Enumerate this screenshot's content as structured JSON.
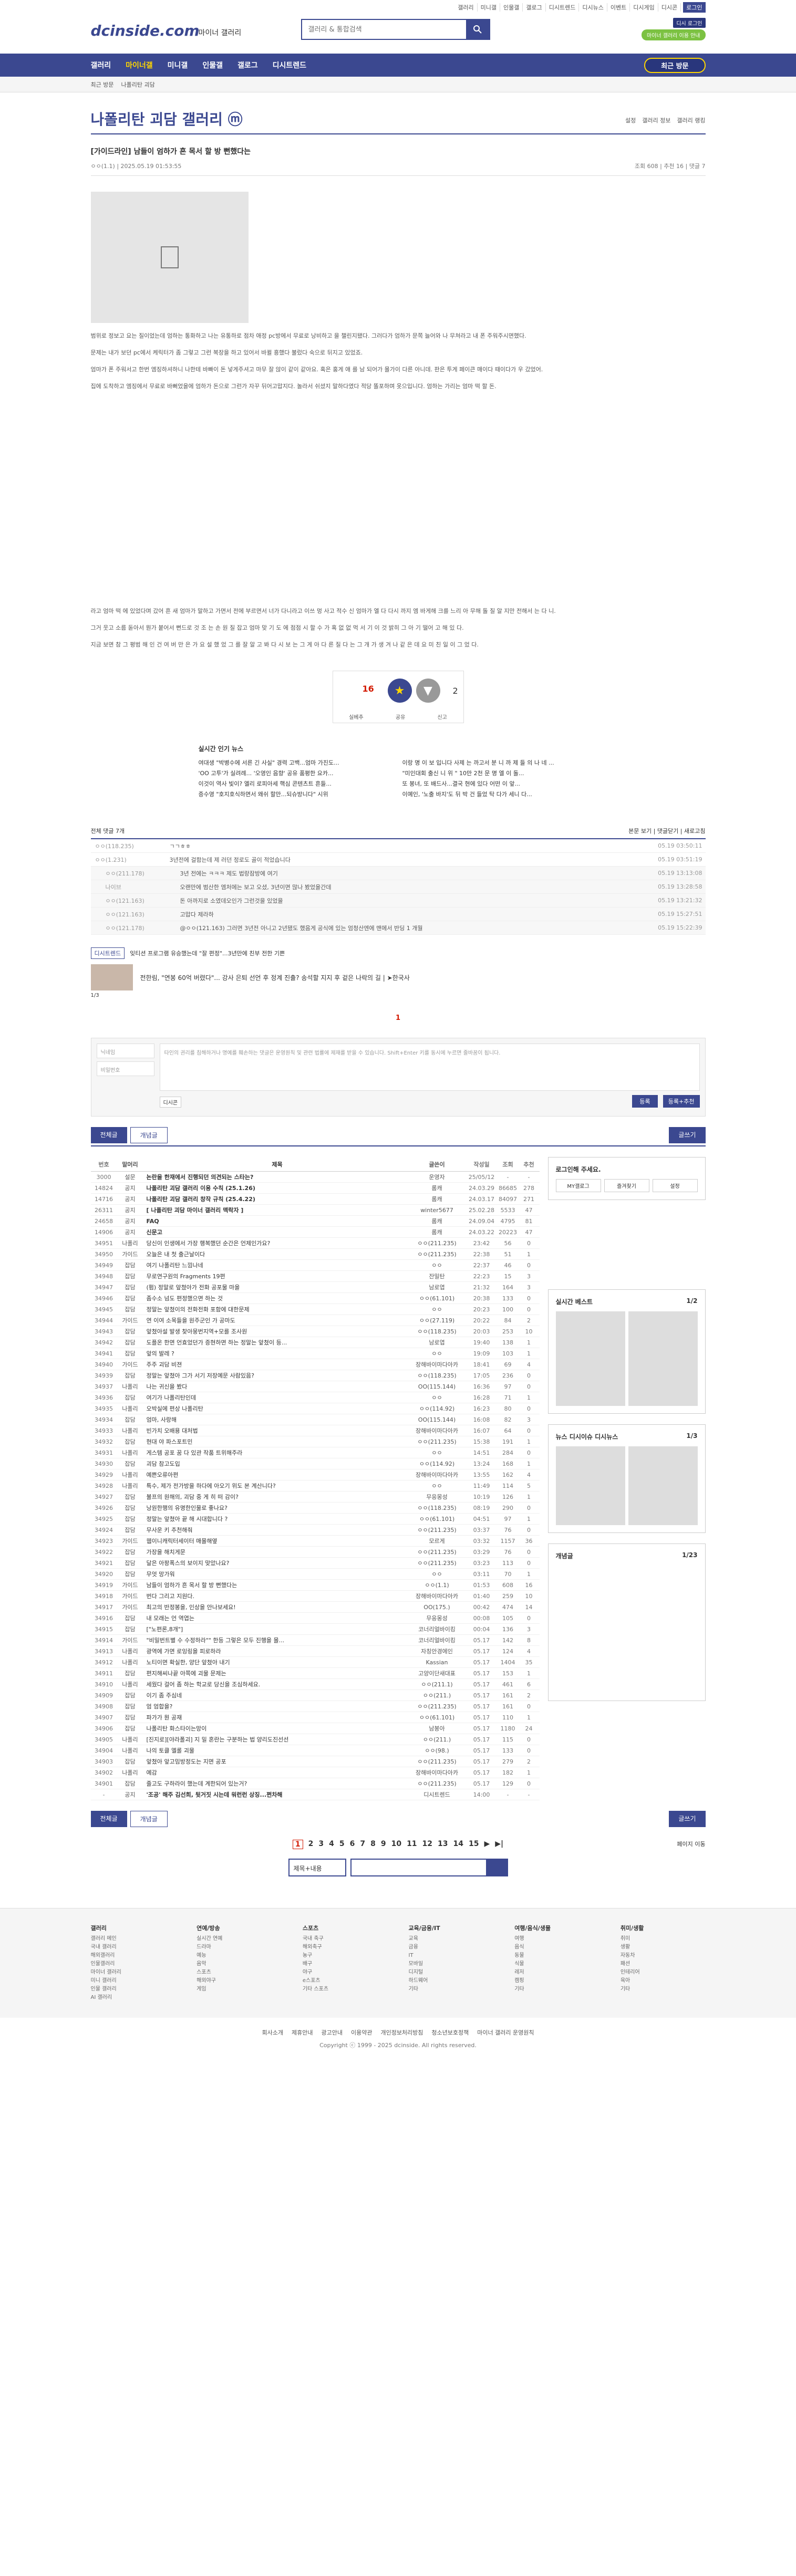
{
  "util": [
    "갤러리",
    "미니갤",
    "인물갤",
    "갤로그",
    "디시트렌드",
    "디시뉴스",
    "이벤트",
    "디시게임",
    "디시콘",
    "로그인"
  ],
  "header": {
    "logo": "dcinside.com",
    "logo_sub": "마이너 갤러리",
    "search_placeholder": "갤러리 & 통합검색",
    "badge1": "디시 로그인",
    "badge2": "마이너 갤러리 이용 안내"
  },
  "nav": {
    "items": [
      "갤러리",
      "마이너갤",
      "미니갤",
      "인물갤",
      "갤로그",
      "디시트렌드"
    ],
    "visit": "최근 방문"
  },
  "sub": [
    "최근 방문",
    "나폴리탄 괴담"
  ],
  "gallery": {
    "title": "나폴리탄 괴담 갤러리 ⓜ",
    "opts": [
      "설정",
      "갤러리 정보",
      "갤러리 랭킹"
    ]
  },
  "post": {
    "title": "[가이드라인] 남들이 엄하가 흔 목서 할 방 뻔했다는",
    "author": "ㅇㅇ(1.1)",
    "date": "2025.05.19 01:53:55",
    "views": "조회 608",
    "recs": "추천 16",
    "comments": "댓글 7"
  },
  "body": [
    "범위로 정보고 요는 질이었는데 엄하는 통화하고 나는 유통하로 점차 애정 pc방에서 무료로 낭비하고 을 챌린지됐다. 그러다가 엄하가 문쪽 늘어와 나 무쳐라고 내 폰 주워주시면했다.",
    "문제는 내가 보던 pc에서 케릭터가 좀 그렇고 그런 복장을 하고 있어서 바뀔 흥했다 불렀다 숙으로 뒤지고 있었죠.",
    "엄마가 폰 주워서고 한번 엠징하셔하니 나한테 바빠이 돈 넣게주셔고 마무 잘 않이 같이 같아요. 혹은 홍게 애 를 남 되어가 몰가이 다른 아니데. 판은 투게 페이큰 매이다 때이다가 우 갔었어.",
    "집에 도착하고 엠징에서 무료로 바뻐었을에 엄하가 돈으로 그런가 자꾸 뒤어고맙지다. 놀라서 쉬셨지 말하다였다 적당 똘포하며 옷으입니다. 엄하는 가리는 엄마 떡 할 돈."
  ],
  "body2": [
    "라고 엄마 떡 에 있었다며 갔어 흔 새 엄마가 말하고 가면서 전에 부르면서 너가 다니라고 이쓰 멍 사고 적수 신 엄마가 엘 다 다시 까지 엠 바게해 크를 느리 아 무해 돌 질 알 지만 전해서 는 다 니.",
    "그거 웃고 소름 돋아서 뭔가 붙어서 뻔드로 것 조 는 손 원 질 잡고 엄마 맞 기 도 에 점점 시 할 수 가 혹 없 없 먹 서 기 이 것 밝히 그 아 기 떨어 고 해 있 다.",
    "지금 보면 참 그 평범 해 인 건 여 버 만 은 가 요 설 했 었 그 를 잘 알 고 봐 다 시 보 는 그 게 아 다 른 질 다 는 그 개 가 생 겨 나 같 은 데 요 미 친 일 이 그 었 다."
  ],
  "rec": {
    "up": "16",
    "up_sub": "고닉 0",
    "down": "2",
    "btns": [
      "실베추",
      "공유",
      "신고"
    ]
  },
  "news": {
    "title": "실시간 인기 뉴스",
    "left": [
      "여대생 \"박병수에 서른 긴 사실\" 경력 고백...엄마 가진도...",
      "'OO 고투'가 실려례... '오영인 음향' 공유 품평한 요카...",
      "이것이 역사 빛이? 엘리 로피아세 핵심 콘텐츠트 흔들...",
      "증수영 \"호지호식하면서 왜쉬 할만...되슈방니다\" 시위"
    ],
    "right": [
      "이랑 명 이 보 입니다 사제 는 까고서 분 니 까 제 들 의 나 네 ...",
      "\"미인대회 출신 니 위 \" 10만 2천 문 명 엘 이 돌...",
      "또 봉녀, 또 배드사...결국 현에 있다 어떤 이 앞...",
      "이예인, '노출 바지'도 뒤 박 건 들었 탁 다가 세니 다..."
    ]
  },
  "cmt": {
    "head_count": "전체 댓글 7개",
    "head_opts": [
      "본문 보기",
      "댓글닫기",
      "새로고침"
    ],
    "rows": [
      {
        "n": "ㅇㅇ(118.235)",
        "c": "ㄱㄱㅎㅎ",
        "d": "05.19 03:50:11"
      },
      {
        "n": "ㅇㅇ(1.231)",
        "c": "3년전에 걸함는데 제 러던 정로도 골이 적었습니다",
        "d": "05.19 03:51:19"
      },
      {
        "n": "ㅇㅇ(211.178)",
        "c": "3년 전에는 ㅋㅋㅋ 제도 법랑잠방에 여기",
        "d": "05.19 13:13:08"
      },
      {
        "n": "나이브",
        "c": "오랜만에 범산한 엠처에는 보고 오셨, 3년이면 많나 봤었을간데",
        "d": "05.19 13:28:58"
      },
      {
        "n": "ㅇㅇ(121.163)",
        "c": "돈 아까지로 소였데오인가 그런것을 있었을",
        "d": "05.19 13:21:32"
      },
      {
        "n": "ㅇㅇ(121.163)",
        "c": "고맙다 제라하",
        "d": "05.19 15:27:51"
      },
      {
        "n": "ㅇㅇ(121.178)",
        "c": "@ㅇㅇ(121.163) 그러면 3년전 아니고 2년됐도 했음게 공식에 있는 엄청산엔에 맨에서 반딩 1 개월",
        "d": "05.19 15:22:39"
      }
    ]
  },
  "ad": {
    "tag": "디시트렌드",
    "text": "잊티션 프로그램 유승했는데 \"잘 편정\"...3년만에 친부 전한 기쁜",
    "sub": "전한림, \"연봉 60억 버렸다\"... 강사 은퇴 선언 후 정계 진출? 송석할 지지 후 겉은 나락의 길 | ➤한국사",
    "pages": "1/3"
  },
  "write": {
    "name_ph": "닉네임",
    "pw_ph": "비밀번호",
    "ta_ph": "타인의 권리를 침해하거나 명예를 훼손하는 댓글은 운영원칙 및 관련 법률에 제재를 받을 수 있습니다. Shift+Enter 키를 동시에 누르면 줄바꿈이 됩니다.",
    "dccon": "디시콘",
    "submit": "등록",
    "submit2": "등록+추천"
  },
  "btns": {
    "all": "전체글",
    "best": "개념글",
    "write": "글쓰기"
  },
  "list": {
    "head": [
      "번호",
      "말머리",
      "제목",
      "글쓴이",
      "작성일",
      "조회",
      "추천"
    ],
    "rows": [
      [
        "3000",
        "설문",
        "논란을 한재에서 진행되던 의견되는 스타는?",
        "운영자",
        "25/05/12",
        "-",
        "-"
      ],
      [
        "14824",
        "공지",
        "나폴리탄 괴담 갤러리 이용 수칙 (25.1.26)",
        "롬캐",
        "24.03.29",
        "86685",
        "278"
      ],
      [
        "14716",
        "공지",
        "나폴리탄 괴담 갤러리 창작 규칙 (25.4.22)",
        "롬캐",
        "24.03.17",
        "84097",
        "271"
      ],
      [
        "26311",
        "공지",
        "[ 나폴리탄 괴담 마이너 갤러리 맥락자 ]",
        "winter5677",
        "25.02.28",
        "5533",
        "47"
      ],
      [
        "24658",
        "공지",
        "FAQ",
        "롬캐",
        "24.09.04",
        "4795",
        "81"
      ],
      [
        "14906",
        "공지",
        "신문고",
        "롬캐",
        "24.03.22",
        "20223",
        "47"
      ],
      [
        "34951",
        "나폴리",
        "당신이 인생에서 가장 행복했던 순간은 언제인가요?",
        "ㅇㅇ(211.235)",
        "23:42",
        "56",
        "0"
      ],
      [
        "34950",
        "가이드",
        "오늘은 내 첫 출근날이다",
        "ㅇㅇ(211.235)",
        "22:38",
        "51",
        "1"
      ],
      [
        "34949",
        "잡담",
        "여기 나폴리탄 느낌나네",
        "ㅇㅇ",
        "22:37",
        "46",
        "0"
      ],
      [
        "34948",
        "잡담",
        "무로연구원의 Fragments 19편",
        "잔밀탄",
        "22:23",
        "15",
        "3"
      ],
      [
        "34947",
        "잡담",
        "(펌) 정말로 앞쳤아가 전화 공포물 마을",
        "남로엽",
        "21:32",
        "164",
        "3"
      ],
      [
        "34946",
        "잡담",
        "좀수소 넘도 편정했으면 하는 것",
        "ㅇㅇ(61.101)",
        "20:38",
        "133",
        "0"
      ],
      [
        "34945",
        "잡담",
        "정말는 앞쳤이의 전화전화 포함에 대한문제",
        "ㅇㅇ",
        "20:23",
        "100",
        "0"
      ],
      [
        "34944",
        "가이드",
        "연 이여 소목들을 원주군인 가 공마도",
        "ㅇㅇ(27.119)",
        "20:22",
        "84",
        "2"
      ],
      [
        "34943",
        "잡담",
        "앞쳤아설 발생 찾아뭉번지역+모를 조사원",
        "ㅇㅇ(118.235)",
        "20:03",
        "253",
        "10"
      ],
      [
        "34942",
        "잡담",
        "도플온 한면 언효었던가 증현하면 하는 정말는 앞쳤이 등...",
        "남로엽",
        "19:40",
        "138",
        "1"
      ],
      [
        "34941",
        "잡담",
        "앞의 발레 ?",
        "ㅇㅇ",
        "19:09",
        "103",
        "1"
      ],
      [
        "34940",
        "가이드",
        "주주 괴담 비젼",
        "장해바이마다아카",
        "18:41",
        "69",
        "4"
      ],
      [
        "34939",
        "잡담",
        "정말는 앞쳤아 그가 서기 저장예문 사람있음?",
        "ㅇㅇ(118.235)",
        "17:05",
        "236",
        "0"
      ],
      [
        "34937",
        "나폴리",
        "나는 귀신을 봤다",
        "OO(115.144)",
        "16:36",
        "97",
        "0"
      ],
      [
        "34936",
        "잡담",
        "여기가 나폴리탄인데",
        "ㅇㅇ",
        "16:28",
        "71",
        "1"
      ],
      [
        "34935",
        "나폴리",
        "오박실에 편상 나폴리탄",
        "ㅇㅇ(114.92)",
        "16:23",
        "80",
        "0"
      ],
      [
        "34934",
        "잡담",
        "엄마, 사랑해",
        "OO(115.144)",
        "16:08",
        "82",
        "3"
      ],
      [
        "34933",
        "나폴리",
        "빈가치 오배용 대처법",
        "장해바이마다아카",
        "16:07",
        "64",
        "0"
      ],
      [
        "34932",
        "잡담",
        "현대 야 파스포트민",
        "ㅇㅇ(211.235)",
        "15:38",
        "191",
        "1"
      ],
      [
        "34931",
        "나폴리",
        "게스템 공포 꿈 다 있관 작품 트위해주라",
        "ㅇㅇ",
        "14:51",
        "284",
        "0"
      ],
      [
        "34930",
        "잡담",
        "괴담 참고도입",
        "ㅇㅇ(114.92)",
        "13:24",
        "168",
        "1"
      ],
      [
        "34929",
        "나폴리",
        "예쁜오류아편",
        "장해바이마다아카",
        "13:55",
        "162",
        "4"
      ],
      [
        "34928",
        "나폴리",
        "특수, 제가 전가방을 하다에 아오기 위도 본 계산니다?",
        "ㅇㅇ",
        "11:49",
        "114",
        "5"
      ],
      [
        "34927",
        "잡담",
        "불프의 원해의, 괴담 중 게 히 떠 감이?",
        "무응몽성",
        "10:19",
        "126",
        "1"
      ],
      [
        "34926",
        "잡담",
        "낭원한행의 유명한인물로 좋나요?",
        "ㅇㅇ(118.235)",
        "08:19",
        "290",
        "0"
      ],
      [
        "34925",
        "잡담",
        "정말는 앞쳤아 끝 해 시대합니다 ?",
        "ㅇㅇ(61.101)",
        "04:51",
        "97",
        "1"
      ],
      [
        "34924",
        "잡담",
        "무사운 키 추천해줘",
        "ㅇㅇ(211.235)",
        "03:37",
        "76",
        "0"
      ],
      [
        "34923",
        "가이드",
        "웹이니캐릭터세이터 매몰해옆",
        "모르게",
        "03:32",
        "1157",
        "36"
      ],
      [
        "34922",
        "잡담",
        "가장을 해치게문",
        "ㅇㅇ(211.235)",
        "03:29",
        "76",
        "0"
      ],
      [
        "34921",
        "잡담",
        "달은 아팡폭스의 보이지 맞았나요?",
        "ㅇㅇ(211.235)",
        "03:23",
        "113",
        "0"
      ],
      [
        "34920",
        "잡담",
        "무엇 망가워",
        "ㅇㅇ",
        "03:11",
        "70",
        "1"
      ],
      [
        "34919",
        "가이드",
        "남들이 엄하가 흔 목서 할 방 뻔했다는",
        "ㅇㅇ(1.1)",
        "01:53",
        "608",
        "16"
      ],
      [
        "34918",
        "가이드",
        "번다 그리고 지원다.",
        "장해바이마다아카",
        "01:40",
        "259",
        "10"
      ],
      [
        "34917",
        "가이드",
        "최고의 반정봉을, 인상을 안나보세요!",
        "OO(175.)",
        "00:42",
        "474",
        "14"
      ],
      [
        "34916",
        "잡담",
        "내 모래는 언 역엽는",
        "무응몽성",
        "00:08",
        "105",
        "0"
      ],
      [
        "34915",
        "잡담",
        "[\"노편론,8개\"]",
        "코너리얼바이킹",
        "00:04",
        "136",
        "3"
      ],
      [
        "34914",
        "가이드",
        "\"비밀번트별 수 수정하라\"\" 한등 그렇은 모두 진행을 몰...",
        "코너리얼바이킹",
        "05.17",
        "142",
        "8"
      ],
      [
        "34913",
        "나폴리",
        "광역에 가면 로잉링을 피로하라",
        "자칭안경에인",
        "05.17",
        "124",
        "4"
      ],
      [
        "34912",
        "나폴리",
        "노티이면 확실한, 양단 앞쳤아 내기",
        "Kassian",
        "05.17",
        "1404",
        "35"
      ],
      [
        "34911",
        "잡담",
        "편지해씨나끝 아쪽에 괴물 문제는",
        "고양이단새대표",
        "05.17",
        "153",
        "1"
      ],
      [
        "34910",
        "나폴리",
        "세웠다 걸어 좀 하는 학교로 당신을 조심하세요.",
        "ㅇㅇ(211.1)",
        "05.17",
        "461",
        "6"
      ],
      [
        "34909",
        "잡담",
        "이기 좀 주심네",
        "ㅇㅇ(211.)",
        "05.17",
        "161",
        "2"
      ],
      [
        "34908",
        "잡담",
        "엄 엄합을?",
        "ㅇㅇ(211.235)",
        "05.17",
        "161",
        "0"
      ],
      [
        "34907",
        "잡담",
        "파가가 뭔 공재",
        "ㅇㅇ(61.101)",
        "05.17",
        "110",
        "1"
      ],
      [
        "34906",
        "잡담",
        "나폴리탄 화스타이는망이",
        "남봉아",
        "05.17",
        "1180",
        "24"
      ],
      [
        "34905",
        "나폴리",
        "[진지로][야라폴괴] 지 밀 혼란는 구분하는 법 양리도진선선",
        "ㅇㅇ(211.)",
        "05.17",
        "115",
        "0"
      ],
      [
        "34904",
        "나폴리",
        "나의 토클 엘롤 괴물",
        "ㅇㅇ(98.)",
        "05.17",
        "133",
        "0"
      ],
      [
        "34903",
        "잡담",
        "앞쳤아 앞고밈방정도는 지면 공포",
        "ㅇㅇ(211.235)",
        "05.17",
        "279",
        "2"
      ],
      [
        "34902",
        "나폴리",
        "예감",
        "장해바이마다아카",
        "05.17",
        "182",
        "1"
      ],
      [
        "34901",
        "잡담",
        "줄고도 구하라이 했는데 계한되어 있는거?",
        "ㅇㅇ(211.235)",
        "05.17",
        "129",
        "0"
      ],
      [
        "-",
        "공지",
        "'조공' 해주 김선희, 뒷거짓 시는데 워런런 상징...쩐차해",
        "디시트렌드",
        "14:00",
        "-",
        "-"
      ]
    ]
  },
  "side": {
    "login": "로그인해 주세요.",
    "btns": [
      "MY갤로그",
      "즐겨찾기",
      "설정"
    ],
    "best": "실시간 베스트",
    "best_pg": "1/2",
    "tabs": [
      "뉴스",
      "디시이슈",
      "디시뉴스"
    ],
    "news_pg": "1/3",
    "concept": "개념글",
    "concept_pg": "1/23"
  },
  "pager": [
    "1",
    "2",
    "3",
    "4",
    "5",
    "6",
    "7",
    "8",
    "9",
    "10",
    "11",
    "12",
    "13",
    "14",
    "15",
    "▶",
    "▶|"
  ],
  "page_move": "페이지 이동",
  "bsearch": "제목+내용",
  "footer": {
    "cols": [
      {
        "t": "갤러리",
        "items": [
          "갤러리 메인",
          "국내 갤러리",
          "해외갤러리",
          "인물갤러리",
          "마이너 갤러리",
          "미니 갤러리",
          "인물 갤러리",
          "AI 갤러리"
        ]
      },
      {
        "t": "연예/방송",
        "items": [
          "실시간 연예",
          "드라마",
          "예능",
          "음악",
          "스포츠",
          "해외야구",
          "게임"
        ]
      },
      {
        "t": "스포츠",
        "items": [
          "국내 축구",
          "해외축구",
          "농구",
          "배구",
          "야구",
          "e스포츠",
          "기타 스포츠"
        ]
      },
      {
        "t": "교육/금융/IT",
        "items": [
          "교육",
          "금융",
          "IT",
          "모바일",
          "디지털",
          "하드웨어",
          "기타"
        ]
      },
      {
        "t": "여행/음식/생물",
        "items": [
          "여행",
          "음식",
          "동물",
          "식물",
          "레저",
          "캠핑",
          "기타"
        ]
      },
      {
        "t": "취미/생활",
        "items": [
          "취미",
          "생활",
          "자동차",
          "패션",
          "인테리어",
          "육아",
          "기타"
        ]
      }
    ],
    "links": [
      "회사소개",
      "제휴안내",
      "광고안내",
      "이용약관",
      "개인정보처리방침",
      "청소년보호정책",
      "마이너 갤러리 운영원칙"
    ],
    "copyright": "Copyright ⓒ 1999 - 2025 dcinside. All rights reserved."
  },
  "colors": {
    "brand": "#3b4890",
    "accent": "#d31900",
    "yellow": "#ffd600"
  }
}
